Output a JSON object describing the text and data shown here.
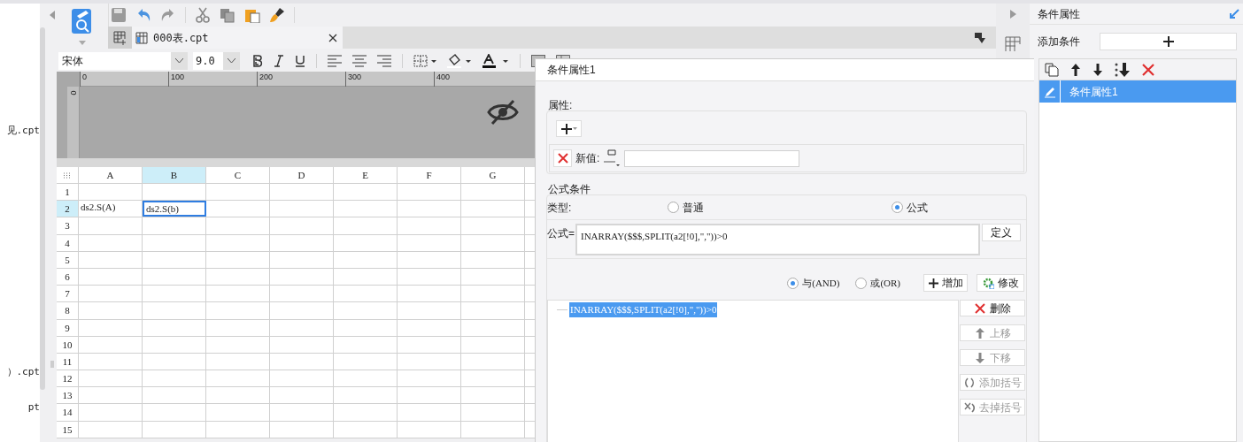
{
  "left_panel": {
    "items": [
      "见.cpt",
      "）.cpt",
      "pt"
    ]
  },
  "file_tab": {
    "label": "000表.cpt"
  },
  "format_toolbar": {
    "font": "宋体",
    "size": "9.0"
  },
  "ruler": {
    "labels": [
      "0",
      "100",
      "200",
      "300",
      "400"
    ],
    "vertical_label": "0"
  },
  "sheet": {
    "columns": [
      {
        "label": "A",
        "selected": false
      },
      {
        "label": "B",
        "selected": true
      },
      {
        "label": "C",
        "selected": false
      },
      {
        "label": "D",
        "selected": false
      },
      {
        "label": "E",
        "selected": false
      },
      {
        "label": "F",
        "selected": false
      },
      {
        "label": "G",
        "selected": false
      }
    ],
    "rows": [
      {
        "label": "1",
        "selected": false,
        "cells": []
      },
      {
        "label": "2",
        "selected": true,
        "cells": [
          {
            "text": "ds2.S(A)",
            "selected": false
          },
          {
            "text": "ds2.S(b)",
            "selected": true
          }
        ]
      },
      {
        "label": "3",
        "selected": false,
        "cells": []
      },
      {
        "label": "4",
        "selected": false,
        "cells": []
      },
      {
        "label": "5",
        "selected": false,
        "cells": []
      },
      {
        "label": "6",
        "selected": false,
        "cells": []
      },
      {
        "label": "7",
        "selected": false,
        "cells": []
      },
      {
        "label": "8",
        "selected": false,
        "cells": []
      },
      {
        "label": "9",
        "selected": false,
        "cells": []
      },
      {
        "label": "10",
        "selected": false,
        "cells": []
      },
      {
        "label": "11",
        "selected": false,
        "cells": []
      },
      {
        "label": "12",
        "selected": false,
        "cells": []
      },
      {
        "label": "13",
        "selected": false,
        "cells": []
      },
      {
        "label": "14",
        "selected": false,
        "cells": []
      },
      {
        "label": "15",
        "selected": false,
        "cells": []
      }
    ]
  },
  "dialog": {
    "title": "条件属性1",
    "property_group": {
      "legend": "属性:",
      "new_value_label": "新值:"
    },
    "formula_group": {
      "legend": "公式条件",
      "type_label": "类型:",
      "type_options": [
        {
          "label": "普通",
          "selected": false
        },
        {
          "label": "公式",
          "selected": true
        }
      ],
      "formula_label": "公式=",
      "formula": "INARRAY($$$,SPLIT(a2[!0],\",\"))>0",
      "define_button": "定义",
      "logic_options": [
        {
          "label": "与(AND)",
          "selected": true
        },
        {
          "label": "或(OR)",
          "selected": false
        }
      ],
      "add_button": "增加",
      "modify_button": "修改",
      "conditions": [
        {
          "text": "INARRAY($$$,SPLIT(a2[!0],\",\"))>0",
          "selected": true
        }
      ],
      "side_buttons": [
        {
          "kind": "delete",
          "label": "删除",
          "disabled": false
        },
        {
          "kind": "up",
          "label": "上移",
          "disabled": true
        },
        {
          "kind": "down",
          "label": "下移",
          "disabled": true
        },
        {
          "kind": "add-bracket",
          "label": "添加括号",
          "disabled": true
        },
        {
          "kind": "remove-bracket",
          "label": "去掉括号",
          "disabled": true
        }
      ]
    }
  },
  "right_panel": {
    "title": "条件属性",
    "add_label": "添加条件",
    "items": [
      {
        "label": "条件属性1",
        "selected": true
      }
    ]
  }
}
